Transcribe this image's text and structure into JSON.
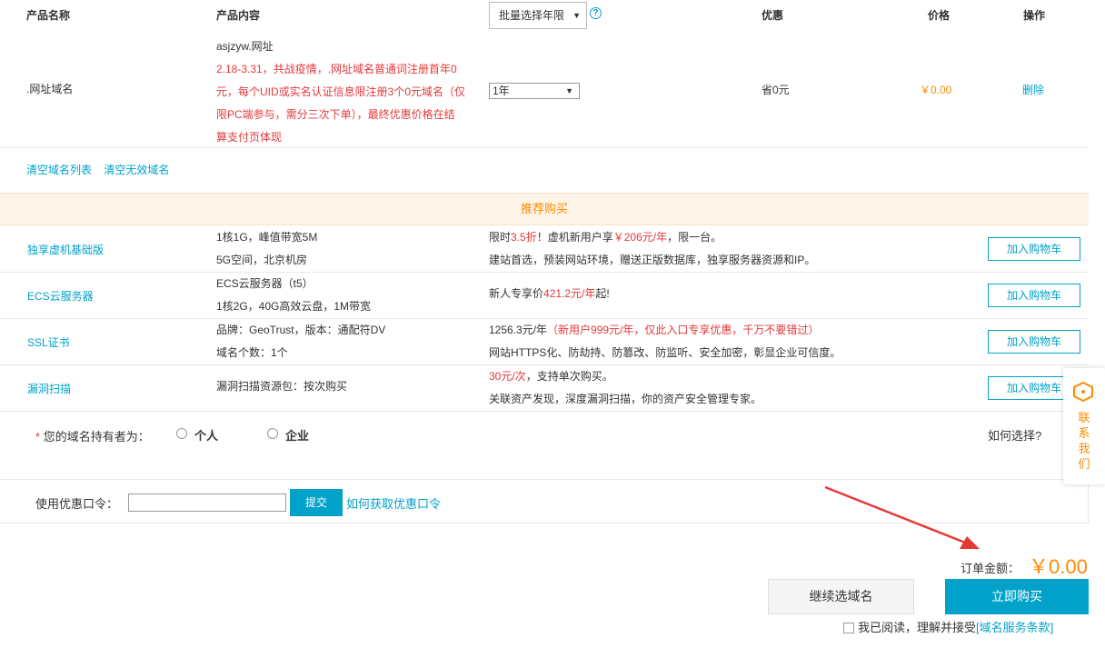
{
  "table_header": {
    "product_name": "产品名称",
    "product_content": "产品内容",
    "batch_select": "批量选择年限",
    "discount": "优惠",
    "price": "价格",
    "action": "操作"
  },
  "domain_item": {
    "name": ".网址域名",
    "domain": "asjzyw.网址",
    "promo_lines": [
      "2.18-3.31，共战疫情，.网址域名普通词注册首年0",
      "元，每个UID或实名认证信息限注册3个0元域名（仅",
      "限PC端参与，需分三次下单），最终优惠价格在结",
      "算支付页体现"
    ],
    "year": "1年",
    "discount": "省0元",
    "price": "￥0.00",
    "delete": "删除"
  },
  "clear_links": {
    "clear_list": "清空域名列表",
    "clear_invalid": "清空无效域名"
  },
  "recommend": {
    "title": "推荐购买",
    "items": [
      {
        "name": "独享虚机基础版",
        "content": [
          "1核1G，峰值带宽5M",
          "5G空间，北京机房"
        ],
        "offer_line1": {
          "a": "限时",
          "b": "3.5折",
          "c": "！虚机新用户享",
          "d": "￥206元/年",
          "e": "，限一台。"
        },
        "offer_line2": "建站首选，预装网站环境，赠送正版数据库，独享服务器资源和IP。",
        "button": "加入购物车"
      },
      {
        "name": "ECS云服务器",
        "content": [
          "ECS云服务器（t5）",
          "1核2G，40G高效云盘，1M带宽"
        ],
        "offer_line1": {
          "a": "新人专享价",
          "b": "421.2元/年",
          "c": "起!"
        },
        "button": "加入购物车"
      },
      {
        "name": "SSL证书",
        "content": [
          "品牌：GeoTrust，版本：通配符DV",
          "域名个数：1个"
        ],
        "offer_line1": {
          "a": "1256.3元/年",
          "b": "（新用户999元/年，仅此入口专享优惠，千万不要错过）"
        },
        "offer_line2": "网站HTTPS化、防劫持、防篡改、防监听、安全加密，彰显企业可信度。",
        "button": "加入购物车"
      },
      {
        "name": "漏洞扫描",
        "content": [
          "漏洞扫描资源包：按次购买"
        ],
        "offer_line1": {
          "a": "30元/次",
          "b": "，支持单次购买。"
        },
        "offer_line2": "关联资产发现，深度漏洞扫描，你的资产安全管理专家。",
        "button": "加入购物车"
      }
    ]
  },
  "holder": {
    "star": "*",
    "label": "您的域名持有者为：",
    "option_personal": "个人",
    "option_company": "企业",
    "how_choose": "如何选择?"
  },
  "coupon": {
    "label": "使用优惠口令：",
    "input_value": "",
    "submit": "提交",
    "help": "如何获取优惠口令"
  },
  "order": {
    "total_label": "订单金额：",
    "total_value": "￥0.00",
    "continue": "继续选域名",
    "buy": "立即购买"
  },
  "agreement": {
    "text": "我已阅读，理解并接受",
    "link": "[域名服务条款]"
  },
  "contact": {
    "label": "联系我们"
  },
  "colors": {
    "accent": "#00a2ca",
    "orange": "#ff8a00",
    "red": "#e4393c",
    "annotation_arrow": "#e53935"
  }
}
